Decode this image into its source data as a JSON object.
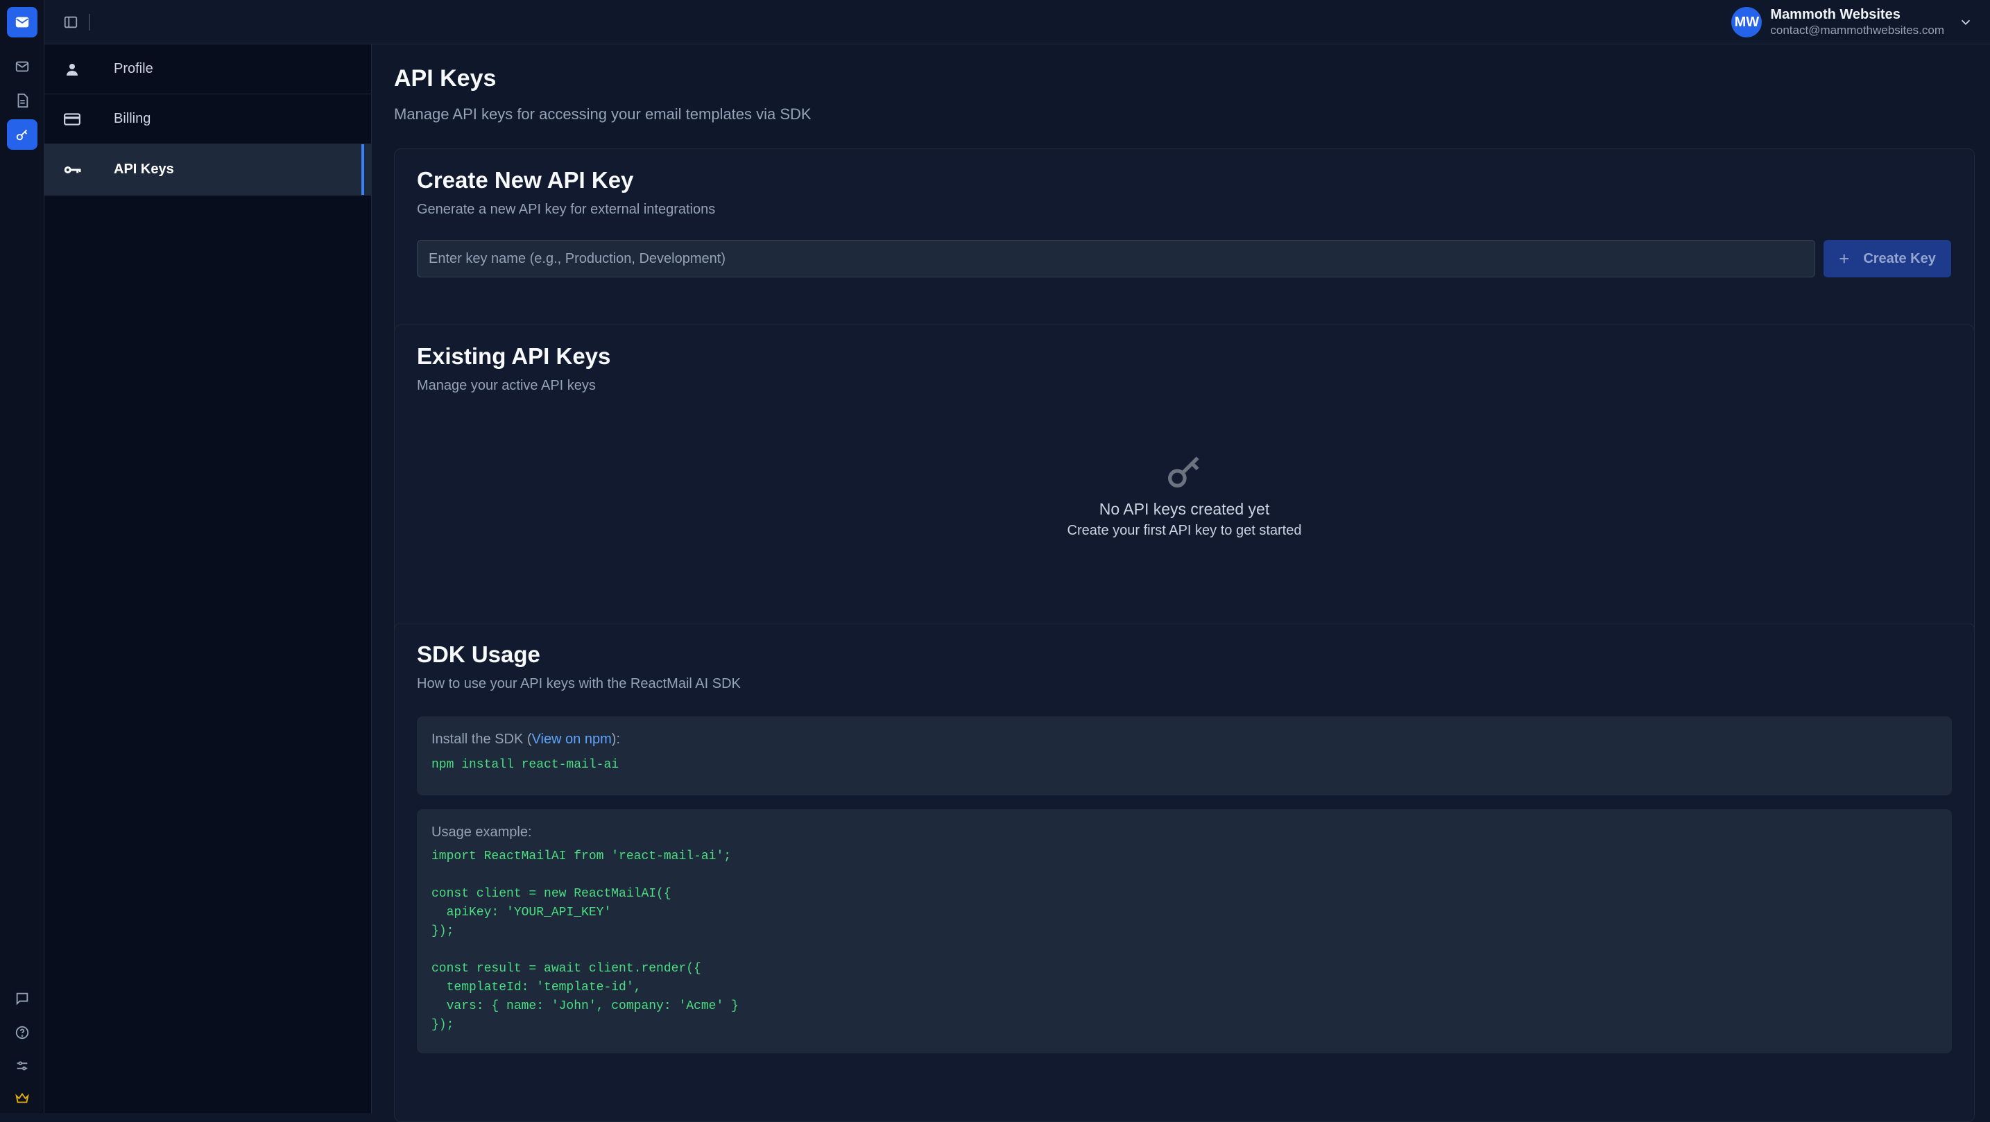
{
  "app": {
    "nav_icons": [
      "mail-icon",
      "document-icon",
      "key-icon"
    ],
    "bottom_icons": [
      "message-icon",
      "help-icon",
      "sliders-icon",
      "crown-icon"
    ]
  },
  "user": {
    "initials": "MW",
    "name": "Mammoth Websites",
    "email": "contact@mammothwebsites.com"
  },
  "sidebar": {
    "items": [
      {
        "label": "Profile",
        "icon": "user-icon"
      },
      {
        "label": "Billing",
        "icon": "credit-card-icon"
      },
      {
        "label": "API Keys",
        "icon": "key-icon",
        "active": true
      }
    ]
  },
  "page": {
    "title": "API Keys",
    "subtitle": "Manage API keys for accessing your email templates via SDK"
  },
  "create_card": {
    "title": "Create New API Key",
    "subtitle": "Generate a new API key for external integrations",
    "input_placeholder": "Enter key name (e.g., Production, Development)",
    "input_value": "",
    "button_label": "Create Key"
  },
  "existing_card": {
    "title": "Existing API Keys",
    "subtitle": "Manage your active API keys",
    "empty_title": "No API keys created yet",
    "empty_subtitle": "Create your first API key to get started"
  },
  "sdk_card": {
    "title": "SDK Usage",
    "subtitle": "How to use your API keys with the ReactMail AI SDK",
    "install_label_prefix": "Install the SDK (",
    "install_link": "View on npm",
    "install_label_suffix": "):",
    "install_command": "npm install react-mail-ai",
    "usage_label": "Usage example:",
    "usage_code": "import ReactMailAI from 'react-mail-ai';\n\nconst client = new ReactMailAI({\n  apiKey: 'YOUR_API_KEY'\n});\n\nconst result = await client.render({\n  templateId: 'template-id',\n  vars: { name: 'John', company: 'Acme' }\n});"
  },
  "colors": {
    "accent": "#2563eb",
    "background": "#0f172a",
    "code_green": "#4ade80",
    "link": "#60a5fa",
    "crown": "#eab308"
  }
}
